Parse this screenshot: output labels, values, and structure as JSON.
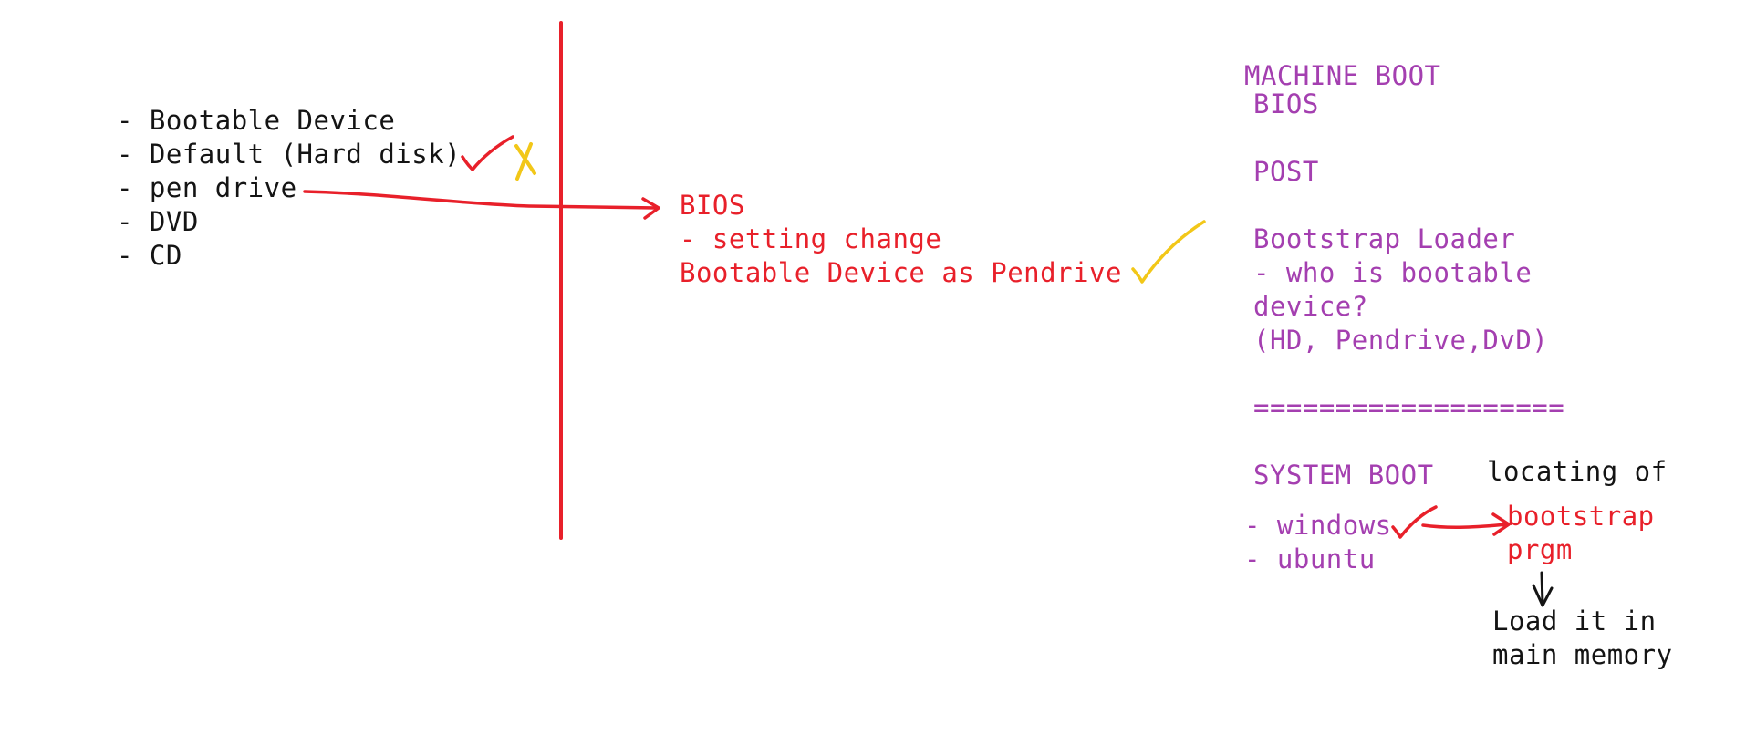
{
  "colors": {
    "black_text": "#141414",
    "red_ink": "#e8202a",
    "purple_text": "#a43fb0",
    "yellow_ink": "#f2c718"
  },
  "left_list": {
    "items": [
      "- Bootable Device",
      "- Default (Hard disk)",
      "- pen drive",
      "- DVD",
      "- CD"
    ]
  },
  "bios_note": {
    "lines": [
      "BIOS",
      "- setting change",
      "Bootable Device as Pendrive"
    ]
  },
  "machine_boot": {
    "title": "MACHINE BOOT",
    "lines": [
      "BIOS",
      "POST",
      "Bootstrap Loader",
      "- who is bootable",
      "device?",
      "(HD, Pendrive,DvD)"
    ],
    "separator": "==================="
  },
  "system_boot": {
    "title": "SYSTEM BOOT",
    "items": [
      "- windows",
      "- ubuntu"
    ],
    "locating_label": "locating of",
    "bootstrap_lines": [
      "bootstrap",
      "prgm"
    ],
    "load_lines": [
      "Load it in",
      "main memory"
    ]
  },
  "marks": {
    "default_checkmark": "checkmark-icon",
    "default_cross": "cross-icon",
    "pendrive_checkmark": "checkmark-icon",
    "windows_checkmark": "checkmark-icon"
  }
}
